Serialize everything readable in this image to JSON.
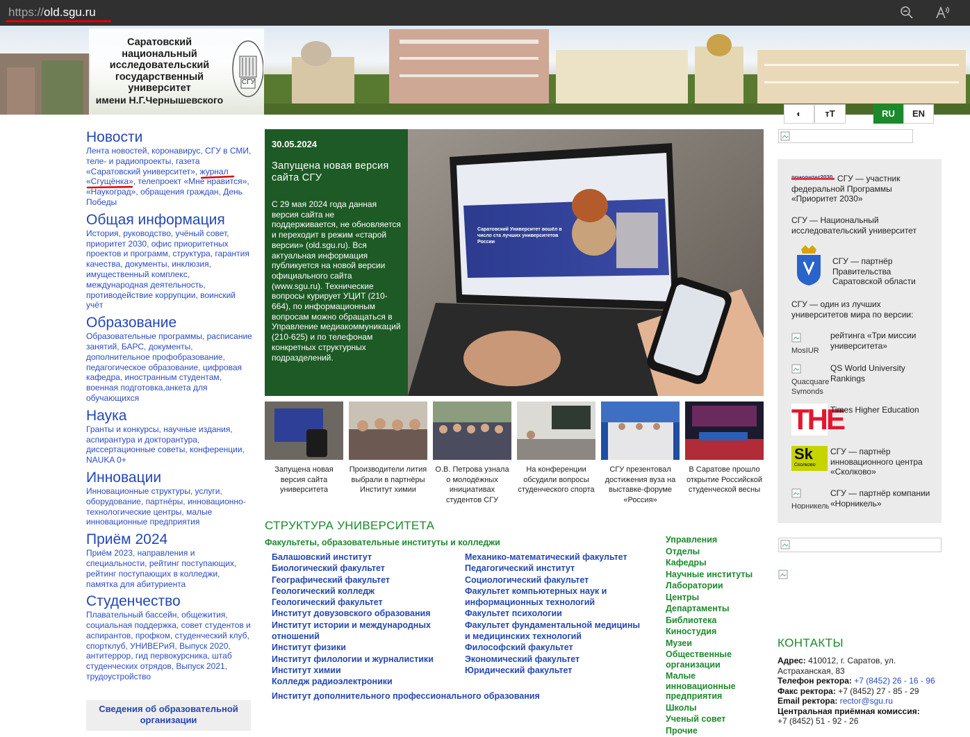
{
  "browser": {
    "url_protocol": "https://",
    "url_host": "old.sgu.ru",
    "zoom_icon": "zoom-out-icon",
    "read_aloud_icon": "read-aloud-icon"
  },
  "header": {
    "university_name": [
      "Саратовский",
      "национальный",
      "исследовательский",
      "государственный",
      "университет",
      "имени Н.Г.Чернышевского"
    ],
    "crest_text": "СГУ"
  },
  "toolbar": {
    "contrast_label": "◐",
    "fontsize_label": "тТ",
    "lang_ru": "RU",
    "lang_en": "EN"
  },
  "left_nav": [
    {
      "title": "Новости",
      "links": "Лента новостей, коронавирус, СГУ в СМИ, теле- и радиопроекты, газета «Саратовский университет», журнал «Сгущёнка», телепроект «Мне нравится», «Наукоград», обращения граждан, День Победы"
    },
    {
      "title": "Общая информация",
      "links": "История, руководство, учёный совет, приоритет 2030, офис приоритетных проектов и программ, структура, гарантия качества, документы, инклюзия, имущественный комплекс, международная деятельность, противодействие коррупции, воинский учёт"
    },
    {
      "title": "Образование",
      "links": "Образовательные программы, расписание занятий, БАРС, документы, дополнительное профобразование, педагогическое образование, цифровая кафедра, иностранным студентам, военная подготовка,анкета для обучающихся"
    },
    {
      "title": "Наука",
      "links": "Гранты и конкурсы, научные издания, аспирантура и докторантура, диссертационные советы, конференции, NAUKA 0+"
    },
    {
      "title": "Инновации",
      "links": "Инновационные структуры, услуги, оборудование, партнёры, инновационно-технологические центры, малые инновационные предприятия"
    },
    {
      "title": "Приём 2024",
      "links": "Приём 2023, направления и специальности, рейтинг поступающих, рейтинг поступающих в колледжи, памятка для абитуриента"
    },
    {
      "title": "Студенчество",
      "links": "Плавательный бассейн, общежития, социальная поддержка, совет студентов и аспирантов, профком, студенческий клуб, спортклуб, УНИВЕРиЯ, Выпуск 2020, антитеррор, гид первокурсника, штаб студенческих отрядов, Выпуск 2021, трудоустройство"
    }
  ],
  "org_info_button": "Сведения об образовательной организации",
  "feature": {
    "date": "30.05.2024",
    "title": "Запущена новая версия сайта СГУ",
    "body": "С 29 мая 2024 года данная версия сайта не поддерживается, не обновляется и переходит в режим «старой версии» (old.sgu.ru). Вся актуальная информация публикуется на новой версии официального сайта (www.sgu.ru). Технические вопросы курирует УЦИТ (210-664), по информационным вопросам можно обращаться в Управление медиакоммуникаций (210-625) и по телефонам конкретных структурных подразделений.",
    "screen_title": "Саратовский Университет вошёл в число ста лучших университетов России"
  },
  "news_thumbs": [
    "Запущена новая версия сайта университета",
    "Производители лития выбрали в партнёры Институт химии",
    "О.В. Петрова узнала о молодёжных инициативах студентов СГУ",
    "На конференции обсудили вопросы студенческого спорта",
    "СГУ презентовал достижения вуза на выставке-форуме «Россия»",
    "В Саратове прошло открытие Российской студенческой весны"
  ],
  "structure": {
    "title": "СТРУКТУРА УНИВЕРСИТЕТА",
    "subtitle": "Факультеты, образовательные институты и колледжи",
    "col1": [
      "Балашовский институт",
      "Биологический факультет",
      "Географический факультет",
      "Геологический колледж",
      "Геологический факультет",
      "Институт довузовского образования",
      "Институт истории и международных отношений",
      "Институт физики",
      "Институт филологии и журналистики",
      "Институт химии",
      "Колледж радиоэлектроники"
    ],
    "col2": [
      "Механико-математический факультет",
      "Педагогический институт",
      "Социологический факультет",
      "Факультет компьютерных наук и информационных технологий",
      "Факультет психологии",
      "Факультет фундаментальной медицины и медицинских технологий",
      "Философский факультет",
      "Экономический факультет",
      "Юридический факультет"
    ],
    "wide": "Институт дополнительного профессионального образования",
    "right_links": [
      "Управления",
      "Отделы",
      "Кафедры",
      "Научные институты",
      "Лаборатории",
      "Центры",
      "Департаменты",
      "Библиотека",
      "Киностудия",
      "Музеи",
      "Общественные организации",
      "Малые инновационные предприятия",
      "Школы",
      "Ученый совет",
      "Прочие"
    ]
  },
  "sidebar": {
    "priority_logo": "приоритет2030",
    "priority_text": "СГУ — участник федеральной Программы «Приоритет 2030»",
    "national_text": "СГУ — Национальный исследовательский университет",
    "gov_text": "СГУ — партнёр Правительства Саратовской области",
    "best_text": "СГУ — один из лучших университетов мира по версии:",
    "mosiur_alt": "MosIUR",
    "mosiur_text": "рейтинга «Три миссии университета»",
    "qs_alt": "Quacquarelli Symonds",
    "qs_text": "QS World University Rankings",
    "the_logo": "THE",
    "the_text": "Times Higher Education",
    "sk_logo": "Sk",
    "sk_sub": "Сколково",
    "sk_text": "СГУ — партнёр инновационного центра «Сколково»",
    "nornik_alt": "Норникель",
    "nornik_text": "СГУ — партнёр компании «Норникель»"
  },
  "contacts": {
    "title": "КОНТАКТЫ",
    "address_label": "Адрес:",
    "address": "410012, г. Саратов, ул. Астраханская, 83",
    "rector_phone_label": "Телефон ректора:",
    "rector_phone": "+7 (8452) 26 - 16 - 96",
    "fax_label": "Факс ректора:",
    "fax": "+7 (8452) 27 - 85 - 29",
    "email_label": "Email ректора:",
    "email": "rector@sgu.ru",
    "commission_label": "Центральная приёмная комиссия:",
    "commission_phone": "+7 (8452) 51 - 92 - 26"
  },
  "colors": {
    "nav_blue": "#2447b3",
    "link_blue": "#2a4bc4",
    "green": "#1c8a2c",
    "feature_green": "#1d5a25",
    "browser_bar": "#303030",
    "annotation_red": "#e00000"
  }
}
